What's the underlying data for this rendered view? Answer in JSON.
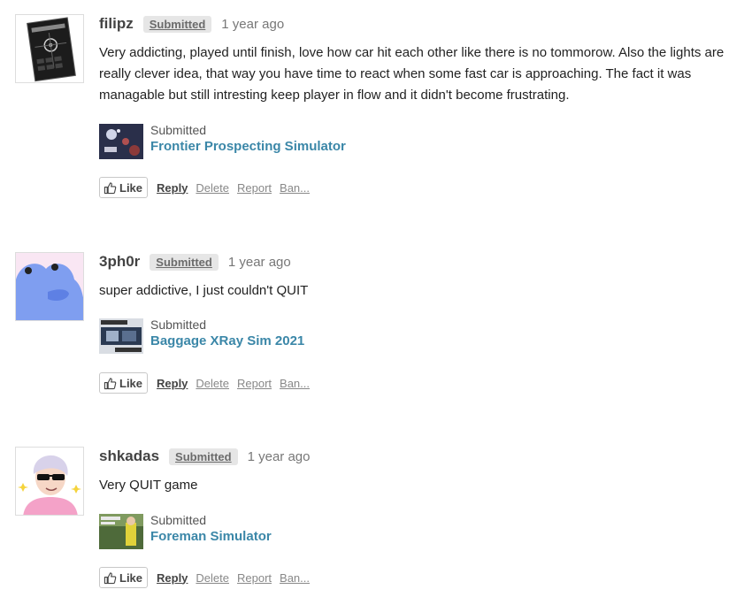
{
  "posts": [
    {
      "username": "filipz",
      "badge": "Submitted",
      "time": "1 year ago",
      "text": "Very addicting, played until finish, love how car hit each other like there is no tommorow. Also the lights are really clever idea, that way you have time to react when some fast car is approaching. The fact it was managable but still intresting keep player in flow and it didn't become frustrating.",
      "game_status": "Submitted",
      "game_title": "Frontier Prospecting Simulator",
      "like_label": "Like",
      "reply_label": "Reply",
      "delete_label": "Delete",
      "report_label": "Report",
      "ban_label": "Ban..."
    },
    {
      "username": "3ph0r",
      "badge": "Submitted",
      "time": "1 year ago",
      "text": "super addictive, I just couldn't QUIT",
      "game_status": "Submitted",
      "game_title": "Baggage XRay Sim 2021",
      "like_label": "Like",
      "reply_label": "Reply",
      "delete_label": "Delete",
      "report_label": "Report",
      "ban_label": "Ban..."
    },
    {
      "username": "shkadas",
      "badge": "Submitted",
      "time": "1 year ago",
      "text": "Very QUIT game",
      "game_status": "Submitted",
      "game_title": "Foreman Simulator",
      "like_label": "Like",
      "reply_label": "Reply",
      "delete_label": "Delete",
      "report_label": "Report",
      "ban_label": "Ban..."
    }
  ],
  "colors": {
    "link": "#3b87a8",
    "badge_bg": "#e6e6e6",
    "muted": "#888888"
  }
}
